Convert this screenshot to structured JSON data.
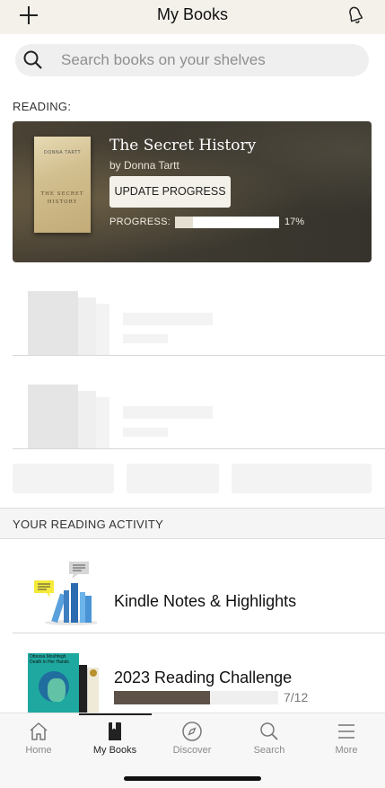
{
  "header": {
    "title": "My Books"
  },
  "search": {
    "placeholder": "Search books on your shelves"
  },
  "reading": {
    "section_label": "READING:",
    "book": {
      "title": "The Secret History",
      "author": "by Donna Tartt",
      "cover_author": "DONNA TARTT",
      "cover_title": "THE SECRET HISTORY"
    },
    "update_button": "UPDATE PROGRESS",
    "progress_label": "PROGRESS:",
    "progress_text": "17%",
    "progress_fraction": 0.17
  },
  "activity": {
    "section_label": "YOUR READING ACTIVITY",
    "notes_title": "Kindle Notes & Highlights",
    "challenge_title": "2023 Reading Challenge",
    "challenge_count": "7/12",
    "challenge_fraction": 0.5833,
    "challenge_cover_text": "Ottessa Moshfegh Death in Her Hands"
  },
  "tabs": [
    {
      "label": "Home",
      "icon": "home-icon"
    },
    {
      "label": "My Books",
      "icon": "my-books-icon",
      "active": true
    },
    {
      "label": "Discover",
      "icon": "compass-icon"
    },
    {
      "label": "Search",
      "icon": "search-icon"
    },
    {
      "label": "More",
      "icon": "menu-icon"
    }
  ],
  "colors": {
    "header_bg": "#f4f1ea",
    "card_bg": "#3e3a31",
    "challenge_fill": "#5e5147"
  }
}
